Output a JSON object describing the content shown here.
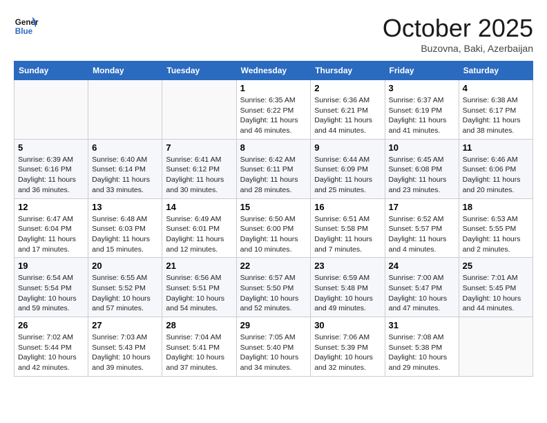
{
  "header": {
    "logo_line1": "General",
    "logo_line2": "Blue",
    "month": "October 2025",
    "location": "Buzovna, Baki, Azerbaijan"
  },
  "weekdays": [
    "Sunday",
    "Monday",
    "Tuesday",
    "Wednesday",
    "Thursday",
    "Friday",
    "Saturday"
  ],
  "weeks": [
    [
      {
        "day": "",
        "info": ""
      },
      {
        "day": "",
        "info": ""
      },
      {
        "day": "",
        "info": ""
      },
      {
        "day": "1",
        "info": "Sunrise: 6:35 AM\nSunset: 6:22 PM\nDaylight: 11 hours and 46 minutes."
      },
      {
        "day": "2",
        "info": "Sunrise: 6:36 AM\nSunset: 6:21 PM\nDaylight: 11 hours and 44 minutes."
      },
      {
        "day": "3",
        "info": "Sunrise: 6:37 AM\nSunset: 6:19 PM\nDaylight: 11 hours and 41 minutes."
      },
      {
        "day": "4",
        "info": "Sunrise: 6:38 AM\nSunset: 6:17 PM\nDaylight: 11 hours and 38 minutes."
      }
    ],
    [
      {
        "day": "5",
        "info": "Sunrise: 6:39 AM\nSunset: 6:16 PM\nDaylight: 11 hours and 36 minutes."
      },
      {
        "day": "6",
        "info": "Sunrise: 6:40 AM\nSunset: 6:14 PM\nDaylight: 11 hours and 33 minutes."
      },
      {
        "day": "7",
        "info": "Sunrise: 6:41 AM\nSunset: 6:12 PM\nDaylight: 11 hours and 30 minutes."
      },
      {
        "day": "8",
        "info": "Sunrise: 6:42 AM\nSunset: 6:11 PM\nDaylight: 11 hours and 28 minutes."
      },
      {
        "day": "9",
        "info": "Sunrise: 6:44 AM\nSunset: 6:09 PM\nDaylight: 11 hours and 25 minutes."
      },
      {
        "day": "10",
        "info": "Sunrise: 6:45 AM\nSunset: 6:08 PM\nDaylight: 11 hours and 23 minutes."
      },
      {
        "day": "11",
        "info": "Sunrise: 6:46 AM\nSunset: 6:06 PM\nDaylight: 11 hours and 20 minutes."
      }
    ],
    [
      {
        "day": "12",
        "info": "Sunrise: 6:47 AM\nSunset: 6:04 PM\nDaylight: 11 hours and 17 minutes."
      },
      {
        "day": "13",
        "info": "Sunrise: 6:48 AM\nSunset: 6:03 PM\nDaylight: 11 hours and 15 minutes."
      },
      {
        "day": "14",
        "info": "Sunrise: 6:49 AM\nSunset: 6:01 PM\nDaylight: 11 hours and 12 minutes."
      },
      {
        "day": "15",
        "info": "Sunrise: 6:50 AM\nSunset: 6:00 PM\nDaylight: 11 hours and 10 minutes."
      },
      {
        "day": "16",
        "info": "Sunrise: 6:51 AM\nSunset: 5:58 PM\nDaylight: 11 hours and 7 minutes."
      },
      {
        "day": "17",
        "info": "Sunrise: 6:52 AM\nSunset: 5:57 PM\nDaylight: 11 hours and 4 minutes."
      },
      {
        "day": "18",
        "info": "Sunrise: 6:53 AM\nSunset: 5:55 PM\nDaylight: 11 hours and 2 minutes."
      }
    ],
    [
      {
        "day": "19",
        "info": "Sunrise: 6:54 AM\nSunset: 5:54 PM\nDaylight: 10 hours and 59 minutes."
      },
      {
        "day": "20",
        "info": "Sunrise: 6:55 AM\nSunset: 5:52 PM\nDaylight: 10 hours and 57 minutes."
      },
      {
        "day": "21",
        "info": "Sunrise: 6:56 AM\nSunset: 5:51 PM\nDaylight: 10 hours and 54 minutes."
      },
      {
        "day": "22",
        "info": "Sunrise: 6:57 AM\nSunset: 5:50 PM\nDaylight: 10 hours and 52 minutes."
      },
      {
        "day": "23",
        "info": "Sunrise: 6:59 AM\nSunset: 5:48 PM\nDaylight: 10 hours and 49 minutes."
      },
      {
        "day": "24",
        "info": "Sunrise: 7:00 AM\nSunset: 5:47 PM\nDaylight: 10 hours and 47 minutes."
      },
      {
        "day": "25",
        "info": "Sunrise: 7:01 AM\nSunset: 5:45 PM\nDaylight: 10 hours and 44 minutes."
      }
    ],
    [
      {
        "day": "26",
        "info": "Sunrise: 7:02 AM\nSunset: 5:44 PM\nDaylight: 10 hours and 42 minutes."
      },
      {
        "day": "27",
        "info": "Sunrise: 7:03 AM\nSunset: 5:43 PM\nDaylight: 10 hours and 39 minutes."
      },
      {
        "day": "28",
        "info": "Sunrise: 7:04 AM\nSunset: 5:41 PM\nDaylight: 10 hours and 37 minutes."
      },
      {
        "day": "29",
        "info": "Sunrise: 7:05 AM\nSunset: 5:40 PM\nDaylight: 10 hours and 34 minutes."
      },
      {
        "day": "30",
        "info": "Sunrise: 7:06 AM\nSunset: 5:39 PM\nDaylight: 10 hours and 32 minutes."
      },
      {
        "day": "31",
        "info": "Sunrise: 7:08 AM\nSunset: 5:38 PM\nDaylight: 10 hours and 29 minutes."
      },
      {
        "day": "",
        "info": ""
      }
    ]
  ]
}
